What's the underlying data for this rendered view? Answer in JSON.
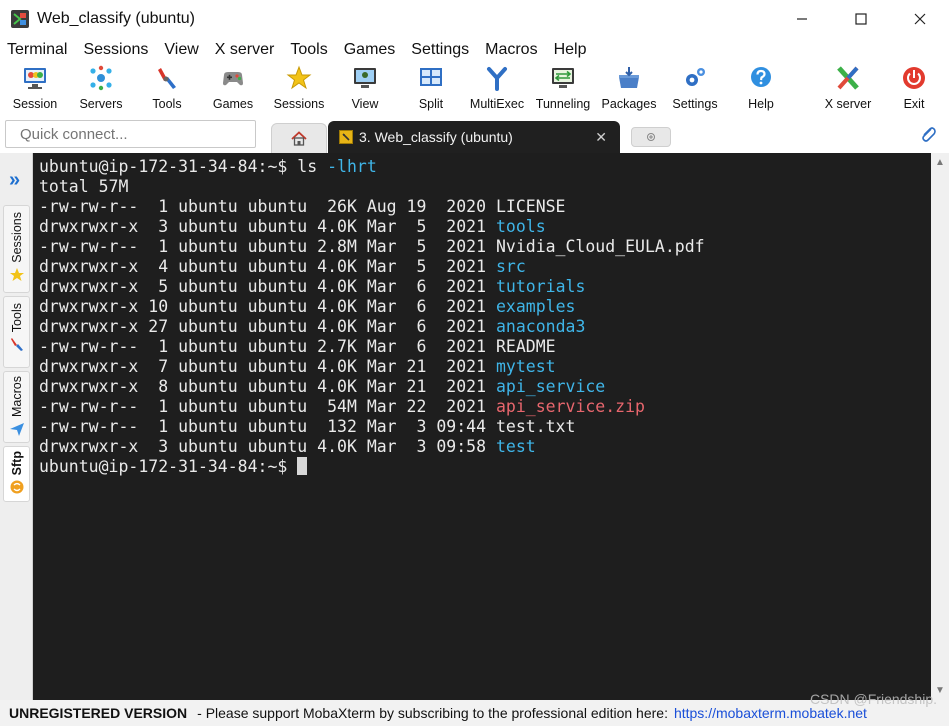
{
  "window": {
    "title": "Web_classify (ubuntu)"
  },
  "menu": [
    "Terminal",
    "Sessions",
    "View",
    "X server",
    "Tools",
    "Games",
    "Settings",
    "Macros",
    "Help"
  ],
  "toolbar": [
    {
      "label": "Session",
      "icon": "session-icon"
    },
    {
      "label": "Servers",
      "icon": "servers-icon"
    },
    {
      "label": "Tools",
      "icon": "tools-icon"
    },
    {
      "label": "Games",
      "icon": "games-icon"
    },
    {
      "label": "Sessions",
      "icon": "star-icon"
    },
    {
      "label": "View",
      "icon": "view-icon"
    },
    {
      "label": "Split",
      "icon": "split-icon"
    },
    {
      "label": "MultiExec",
      "icon": "multiexec-icon"
    },
    {
      "label": "Tunneling",
      "icon": "tunneling-icon"
    },
    {
      "label": "Packages",
      "icon": "packages-icon"
    },
    {
      "label": "Settings",
      "icon": "settings-icon"
    },
    {
      "label": "Help",
      "icon": "help-icon"
    },
    {
      "label": "X server",
      "icon": "xserver-icon"
    },
    {
      "label": "Exit",
      "icon": "exit-icon"
    }
  ],
  "quick_connect": {
    "placeholder": "Quick connect..."
  },
  "tabs": {
    "active_label": "3. Web_classify (ubuntu)",
    "close_glyph": "✕"
  },
  "side_panel": {
    "tabs": [
      {
        "label": "Sessions",
        "icon": "star-icon"
      },
      {
        "label": "Tools",
        "icon": "tools-icon"
      },
      {
        "label": "Macros",
        "icon": "macros-icon"
      },
      {
        "label": "Sftp",
        "icon": "sftp-icon"
      }
    ]
  },
  "terminal": {
    "lines": [
      [
        {
          "text": "ubuntu@ip-172-31-34-84:~$ ls ",
          "style": "default"
        },
        {
          "text": "-lhrt",
          "style": "dir"
        }
      ],
      [
        {
          "text": "total 57M",
          "style": "default"
        }
      ],
      [
        {
          "text": "-rw-rw-r--  1 ubuntu ubuntu  26K Aug 19  2020 LICENSE",
          "style": "default"
        }
      ],
      [
        {
          "text": "drwxrwxr-x  3 ubuntu ubuntu 4.0K Mar  5  2021 ",
          "style": "default"
        },
        {
          "text": "tools",
          "style": "dir"
        }
      ],
      [
        {
          "text": "-rw-rw-r--  1 ubuntu ubuntu 2.8M Mar  5  2021 Nvidia_Cloud_EULA.pdf",
          "style": "default"
        }
      ],
      [
        {
          "text": "drwxrwxr-x  4 ubuntu ubuntu 4.0K Mar  5  2021 ",
          "style": "default"
        },
        {
          "text": "src",
          "style": "dir"
        }
      ],
      [
        {
          "text": "drwxrwxr-x  5 ubuntu ubuntu 4.0K Mar  6  2021 ",
          "style": "default"
        },
        {
          "text": "tutorials",
          "style": "dir"
        }
      ],
      [
        {
          "text": "drwxrwxr-x 10 ubuntu ubuntu 4.0K Mar  6  2021 ",
          "style": "default"
        },
        {
          "text": "examples",
          "style": "dir"
        }
      ],
      [
        {
          "text": "drwxrwxr-x 27 ubuntu ubuntu 4.0K Mar  6  2021 ",
          "style": "default"
        },
        {
          "text": "anaconda3",
          "style": "dir"
        }
      ],
      [
        {
          "text": "-rw-rw-r--  1 ubuntu ubuntu 2.7K Mar  6  2021 README",
          "style": "default"
        }
      ],
      [
        {
          "text": "drwxrwxr-x  7 ubuntu ubuntu 4.0K Mar 21  2021 ",
          "style": "default"
        },
        {
          "text": "mytest",
          "style": "dir"
        }
      ],
      [
        {
          "text": "drwxrwxr-x  8 ubuntu ubuntu 4.0K Mar 21  2021 ",
          "style": "default"
        },
        {
          "text": "api_service",
          "style": "dir"
        }
      ],
      [
        {
          "text": "-rw-rw-r--  1 ubuntu ubuntu  54M Mar 22  2021 ",
          "style": "default"
        },
        {
          "text": "api_service.zip",
          "style": "arch"
        }
      ],
      [
        {
          "text": "-rw-rw-r--  1 ubuntu ubuntu  132 Mar  3 09:44 test.txt",
          "style": "default"
        }
      ],
      [
        {
          "text": "drwxrwxr-x  3 ubuntu ubuntu 4.0K Mar  3 09:58 ",
          "style": "default"
        },
        {
          "text": "test",
          "style": "dir"
        }
      ],
      [
        {
          "text": "ubuntu@ip-172-31-34-84:~$ ",
          "style": "default"
        }
      ]
    ]
  },
  "status": {
    "unregistered": "UNREGISTERED VERSION",
    "message": "-  Please support MobaXterm by subscribing to the professional edition here:",
    "link": "https://mobaxterm.mobatek.net"
  },
  "watermark": "CSDN @Friendship.",
  "colors": {
    "terminal_bg": "#1e1e1e",
    "terminal_fg": "#eaeaea",
    "directory": "#3fb5e8",
    "archive": "#e8666d",
    "link": "#1a4fd8"
  }
}
